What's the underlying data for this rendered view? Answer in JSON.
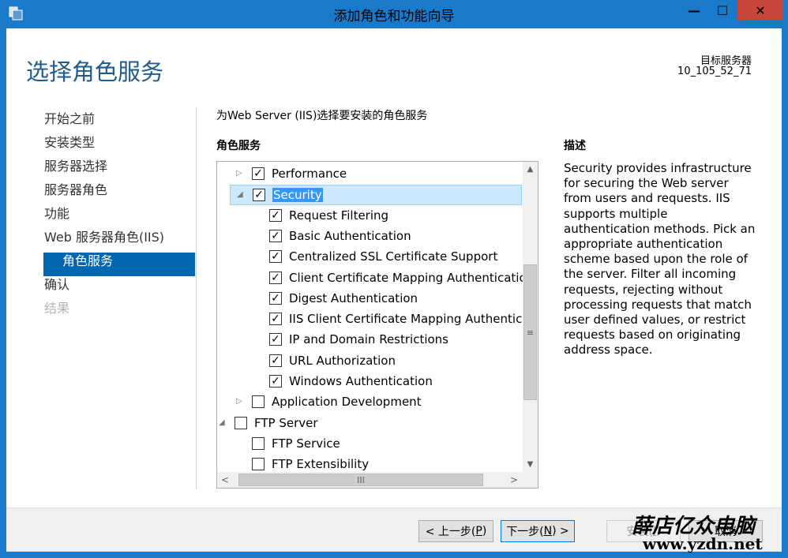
{
  "window": {
    "title": "添加角色和功能向导",
    "accent": "#1979ca"
  },
  "title_controls": {
    "minimize": "—",
    "maximize": "☐",
    "close": "✕"
  },
  "page_title": "选择角色服务",
  "destination": {
    "label": "目标服务器",
    "server": "10_105_52_71"
  },
  "nav": [
    {
      "label": "开始之前",
      "state": "normal"
    },
    {
      "label": "安装类型",
      "state": "normal"
    },
    {
      "label": "服务器选择",
      "state": "normal"
    },
    {
      "label": "服务器角色",
      "state": "normal"
    },
    {
      "label": "功能",
      "state": "normal"
    },
    {
      "label": "Web 服务器角色(IIS)",
      "state": "normal"
    },
    {
      "label": "角色服务",
      "state": "active"
    },
    {
      "label": "确认",
      "state": "normal"
    },
    {
      "label": "结果",
      "state": "disabled"
    }
  ],
  "subtitle": "为Web Server (IIS)选择要安装的角色服务",
  "roles_header": "角色服务",
  "tree": [
    {
      "label": "Performance",
      "checked": true,
      "expander": "▷"
    },
    {
      "label": "Security",
      "checked": true,
      "expander": "◢",
      "selected": true
    },
    {
      "label": "Request Filtering",
      "checked": true,
      "expander": ""
    },
    {
      "label": "Basic Authentication",
      "checked": true,
      "expander": ""
    },
    {
      "label": "Centralized SSL Certificate Support",
      "checked": true,
      "expander": ""
    },
    {
      "label": "Client Certificate Mapping Authentication",
      "checked": true,
      "expander": ""
    },
    {
      "label": "Digest Authentication",
      "checked": true,
      "expander": ""
    },
    {
      "label": "IIS Client Certificate Mapping Authentication",
      "checked": true,
      "expander": ""
    },
    {
      "label": "IP and Domain Restrictions",
      "checked": true,
      "expander": ""
    },
    {
      "label": "URL Authorization",
      "checked": true,
      "expander": ""
    },
    {
      "label": "Windows Authentication",
      "checked": true,
      "expander": ""
    },
    {
      "label": "Application Development",
      "checked": false,
      "expander": "▷"
    },
    {
      "label": "FTP Server",
      "checked": false,
      "expander": "◢"
    },
    {
      "label": "FTP Service",
      "checked": false,
      "expander": ""
    },
    {
      "label": "FTP Extensibility",
      "checked": false,
      "expander": ""
    }
  ],
  "scroll": {
    "up": "▲",
    "down": "▼",
    "left": "<",
    "right": ">",
    "grip_v": "≡",
    "grip_h": "III"
  },
  "description": {
    "header": "描述",
    "text": "Security provides infrastructure for securing the Web server from users and requests. IIS supports multiple authentication methods. Pick an appropriate authentication scheme based upon the role of the server. Filter all incoming requests, rejecting without processing requests that match user defined values, or restrict requests based on originating address space."
  },
  "buttons": {
    "prev": {
      "pre": "< 上一步(",
      "key": "P",
      "post": ")"
    },
    "next": {
      "pre": "下一步(",
      "key": "N",
      "post": ") >"
    },
    "install": {
      "pre": "安装(",
      "key": "I",
      "post": ")"
    },
    "cancel": "取消"
  },
  "watermark": {
    "logo": "薛店亿众电脑",
    "url": "www.yzdn.net"
  }
}
